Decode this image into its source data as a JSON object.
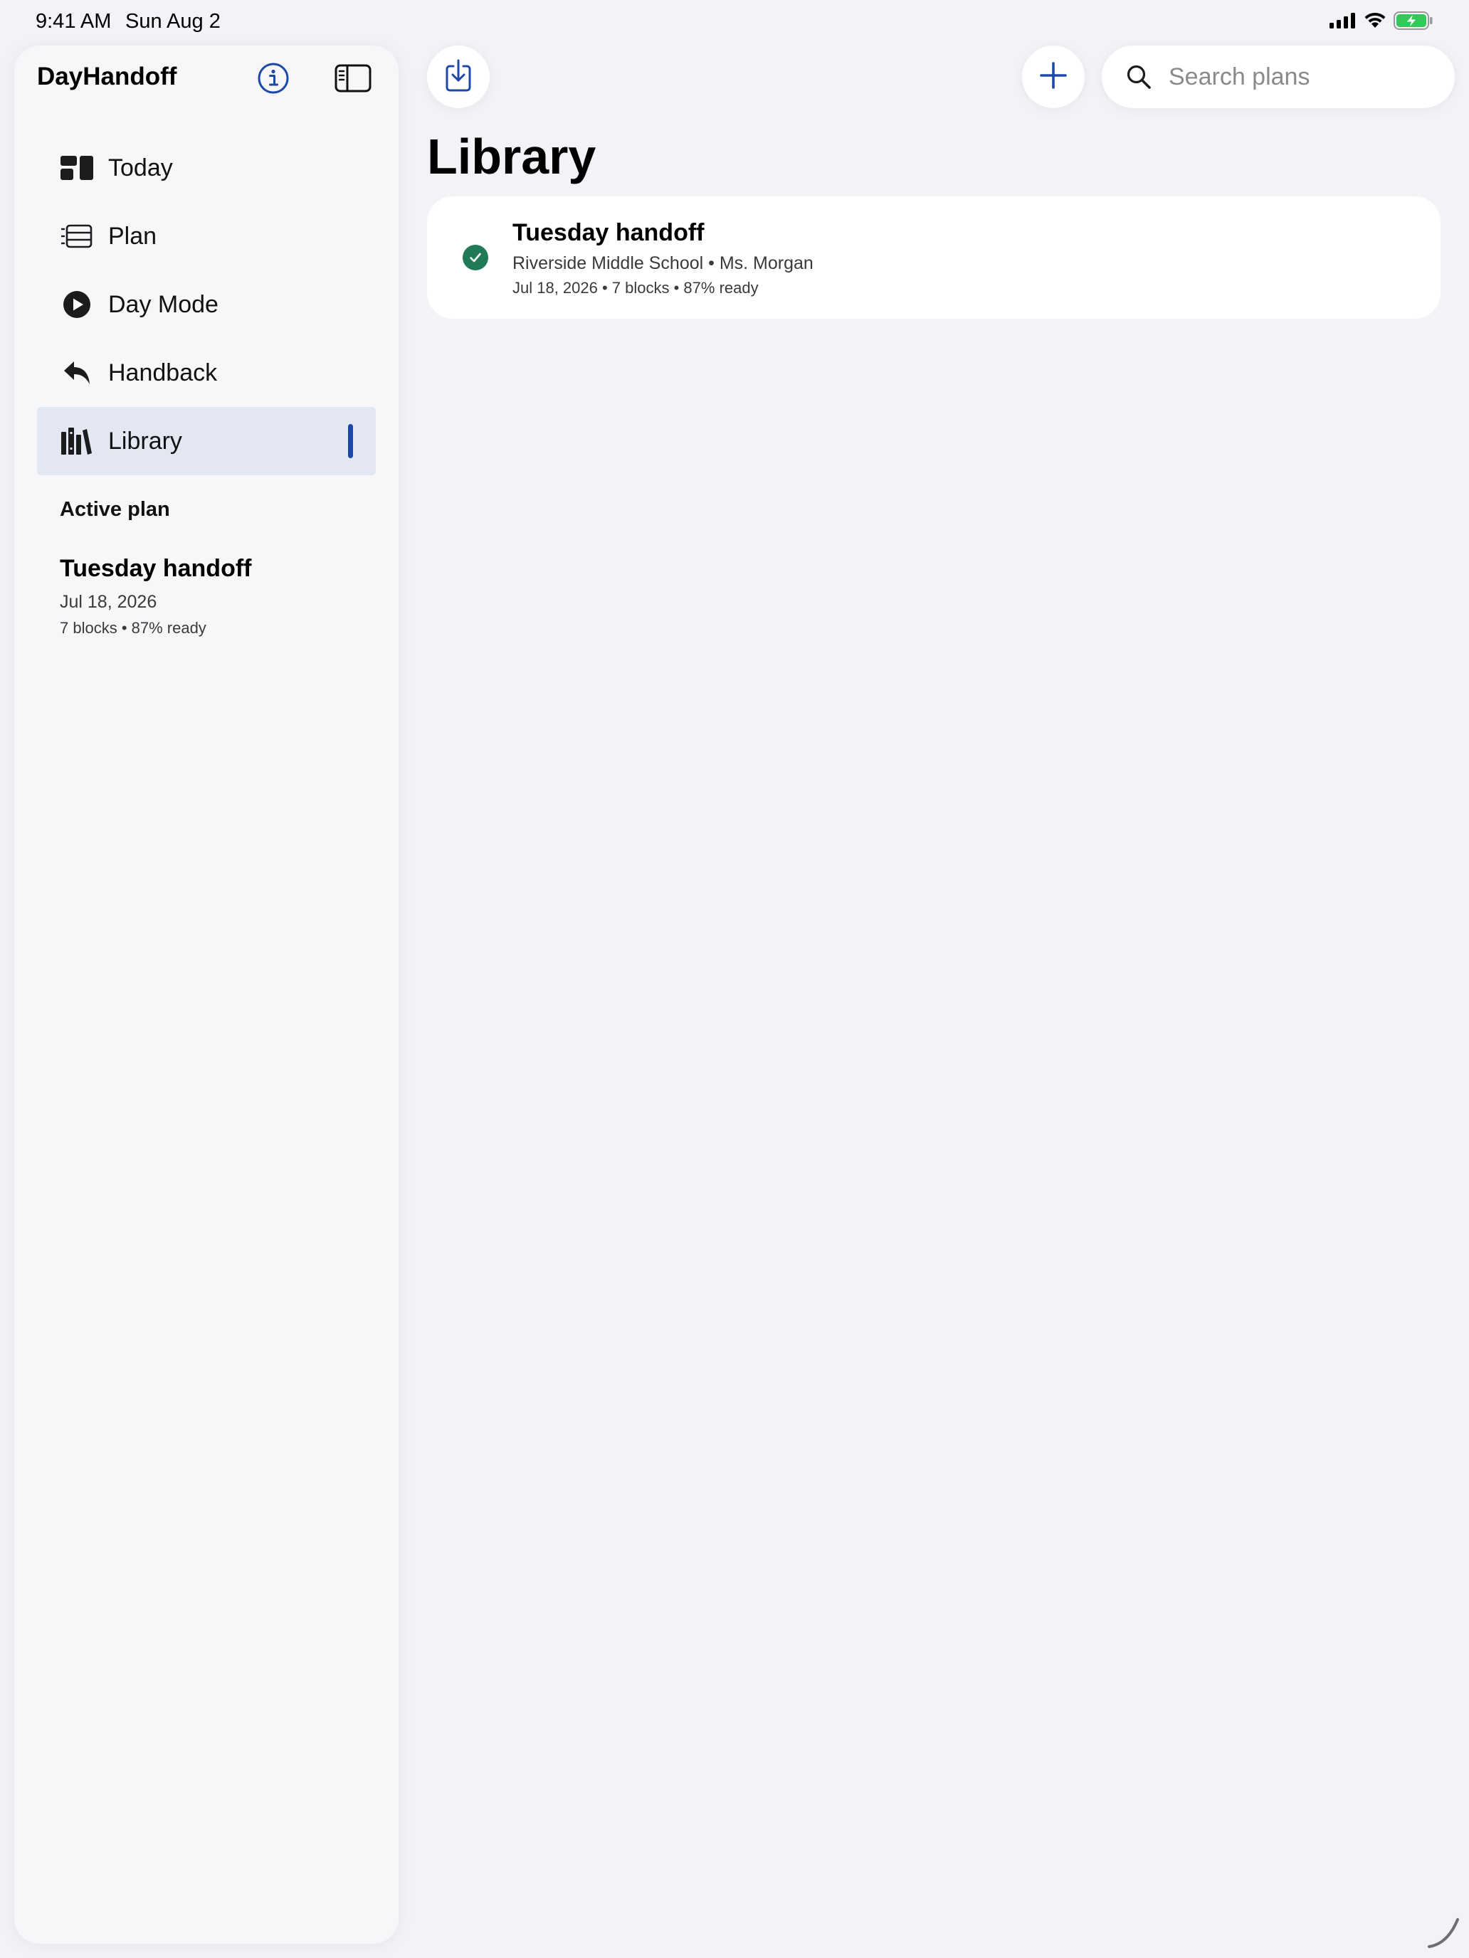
{
  "status_bar": {
    "time": "9:41 AM",
    "date": "Sun Aug 2",
    "icons": [
      "cellular-signal-icon",
      "wifi-icon",
      "battery-charging-icon"
    ]
  },
  "sidebar": {
    "app_title": "DayHandoff",
    "header_icons": [
      "info-icon",
      "sidebar-toggle-icon"
    ],
    "items": [
      {
        "label": "Today",
        "icon": "today-dashboard-icon",
        "selected": false
      },
      {
        "label": "Plan",
        "icon": "plan-list-icon",
        "selected": false
      },
      {
        "label": "Day Mode",
        "icon": "play-circle-icon",
        "selected": false
      },
      {
        "label": "Handback",
        "icon": "reply-arrow-icon",
        "selected": false
      },
      {
        "label": "Library",
        "icon": "books-icon",
        "selected": true
      }
    ],
    "active_plan": {
      "heading": "Active plan",
      "title": "Tuesday handoff",
      "date": "Jul 18, 2026",
      "meta": "7 blocks • 87% ready"
    }
  },
  "toolbar": {
    "import_icon": "import-download-icon",
    "add_icon": "plus-icon",
    "search": {
      "placeholder": "Search plans",
      "value": ""
    }
  },
  "main": {
    "title": "Library",
    "plans": [
      {
        "title": "Tuesday handoff",
        "subtitle": "Riverside Middle School • Ms. Morgan",
        "meta": "Jul 18, 2026 • 7 blocks • 87% ready",
        "status_icon": "checkmark-circle-icon"
      }
    ]
  },
  "colors": {
    "accent": "#1c49a8",
    "background": "#f2f2f7",
    "sidebar_background": "#f7f7fa",
    "selected_row": "#e3e7f2",
    "success": "#1f7a55",
    "battery": "#34c759"
  }
}
